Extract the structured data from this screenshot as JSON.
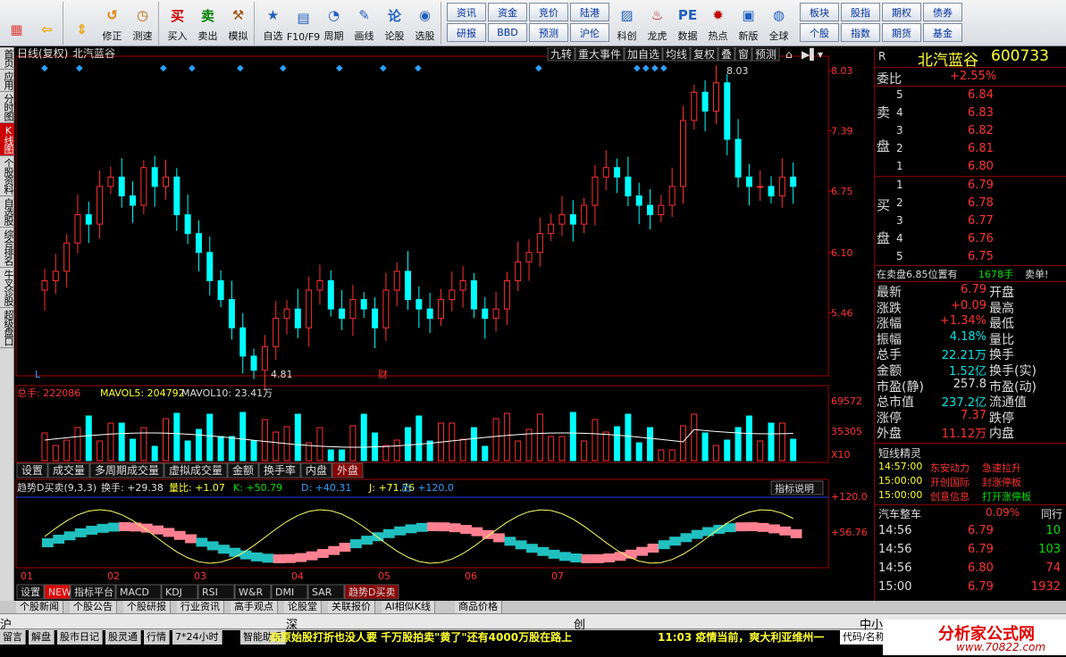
{
  "toolbar": [
    {
      "label": "",
      "icon": "grid-icon"
    },
    {
      "label": "",
      "icon": "back-arrow-icon"
    },
    {
      "label": "",
      "icon": "updown-arrow-icon"
    },
    {
      "label": "修正",
      "icon": "revise-icon"
    },
    {
      "label": "测速",
      "icon": "clock-icon"
    },
    {
      "label": "买入",
      "icon": "buy-icon",
      "glyph": "买"
    },
    {
      "label": "卖出",
      "icon": "sell-icon",
      "glyph": "卖"
    },
    {
      "label": "模拟",
      "icon": "gavel-icon"
    },
    {
      "label": "自选",
      "icon": "star-icon"
    },
    {
      "label": "F10/F9",
      "icon": "f10-icon"
    },
    {
      "label": "周期",
      "icon": "period-icon"
    },
    {
      "label": "画线",
      "icon": "pencil-icon"
    },
    {
      "label": "论股",
      "icon": "discuss-icon",
      "glyph": "论"
    },
    {
      "label": "选股",
      "icon": "pick-icon"
    }
  ],
  "quick_buttons": [
    "资讯",
    "资金",
    "竞价",
    "陆港",
    "研报",
    "BBD",
    "预测",
    "沪伦"
  ],
  "toolbar2": [
    {
      "label": "科创",
      "icon": "chart-icon"
    },
    {
      "label": "龙虎",
      "icon": "dragon-icon"
    },
    {
      "label": "数据",
      "icon": "pe-icon"
    },
    {
      "label": "热点",
      "icon": "hot-icon"
    },
    {
      "label": "新版",
      "icon": "window-icon"
    },
    {
      "label": "全球",
      "icon": "globe-icon"
    }
  ],
  "right_buttons": [
    "板块",
    "股指",
    "期权",
    "债券",
    "个股",
    "指数",
    "期货",
    "基金"
  ],
  "left_tabs": [
    {
      "label": "首页",
      "active": false
    },
    {
      "label": "应用",
      "active": false
    },
    {
      "label": "分时图",
      "active": false
    },
    {
      "label": "K线图",
      "active": true
    },
    {
      "label": "个股资料",
      "active": false
    },
    {
      "label": "自选股",
      "active": false
    },
    {
      "label": "综合排名",
      "active": false
    },
    {
      "label": "牛叉诊股",
      "active": false
    },
    {
      "label": "超级盘口",
      "active": false
    }
  ],
  "chart_header": {
    "period": "日线(复权)",
    "name": "北汽蓝谷"
  },
  "chart_tools": [
    "九转",
    "重大事件",
    "加自选",
    "均线",
    "复权",
    "叠",
    "窗",
    "预测"
  ],
  "price_axis": [
    "8.03",
    "7.39",
    "6.75",
    "6.10",
    "5.46"
  ],
  "high_label": "8.03",
  "low_label": "4.81",
  "mark_L": "L",
  "mark_cai": "财",
  "vol_header": {
    "total": "总手: 222086",
    "mavol5": "MAVOL5: 204792",
    "mavol10": "MAVOL10: 23.41万"
  },
  "vol_axis": [
    "69572",
    "35305",
    "X10"
  ],
  "vol_tabs": [
    "设置",
    "成交量",
    "多周期成交量",
    "虚拟成交量",
    "金额",
    "换手率",
    "内盘",
    "外盘"
  ],
  "ind_header": {
    "name": "趋势D买卖(9,3,3)",
    "hs": "换手: +29.38",
    "lb": "量比: +1.07",
    "k": "K: +50.79",
    "d": "D: +40.31",
    "j": "J: +71.76",
    "out": "出: +120.0"
  },
  "ind_button": "指标说明",
  "ind_axis": [
    "+120.0",
    "+56.76"
  ],
  "x_labels": [
    "01",
    "02",
    "03",
    "04",
    "05",
    "06",
    "07"
  ],
  "ind_tabs": [
    "设置",
    "NEW",
    "指标平台",
    "MACD",
    "KDJ",
    "RSI",
    "W&R",
    "DMI",
    "SAR",
    "趋势D买卖"
  ],
  "stock": {
    "tag": "R",
    "name": "北汽蓝谷",
    "code": "600733"
  },
  "weibi": {
    "label": "委比",
    "value": "+2.55%"
  },
  "sell": [
    {
      "n": "5",
      "p": "6.84"
    },
    {
      "n": "4",
      "p": "6.83"
    },
    {
      "n": "3",
      "p": "6.82"
    },
    {
      "n": "2",
      "p": "6.81"
    },
    {
      "n": "1",
      "p": "6.80"
    }
  ],
  "buy": [
    {
      "n": "1",
      "p": "6.79"
    },
    {
      "n": "2",
      "p": "6.78"
    },
    {
      "n": "3",
      "p": "6.77"
    },
    {
      "n": "4",
      "p": "6.76"
    },
    {
      "n": "5",
      "p": "6.75"
    }
  ],
  "sell_label": "卖盘",
  "buy_label": "买盘",
  "note": {
    "text": "在卖盘6.85位置有",
    "qty": "1678手",
    "tail": "卖单!"
  },
  "stats": [
    {
      "l": "最新",
      "v": "6.79",
      "r": "开盘"
    },
    {
      "l": "涨跌",
      "v": "+0.09",
      "r": "最高"
    },
    {
      "l": "涨幅",
      "v": "+1.34%",
      "r": "最低"
    },
    {
      "l": "振幅",
      "v": "4.18%",
      "r": "量比"
    },
    {
      "l": "总手",
      "v": "22.21万",
      "r": "换手"
    },
    {
      "l": "金额",
      "v": "1.52亿",
      "r": "换手(实)"
    },
    {
      "l": "市盈(静)",
      "v": "257.8",
      "r": "市盈(动)"
    },
    {
      "l": "总市值",
      "v": "237.2亿",
      "r": "流通值"
    },
    {
      "l": "涨停",
      "v": "7.37",
      "r": "跌停"
    },
    {
      "l": "外盘",
      "v": "11.12万",
      "r": "内盘"
    }
  ],
  "short_title": "短线精灵",
  "short": [
    {
      "t": "14:57:00",
      "n": "东安动力",
      "e": "急速拉升"
    },
    {
      "t": "15:00:00",
      "n": "开创国际",
      "e": "封涨停板"
    },
    {
      "t": "15:00:00",
      "n": "创意信息",
      "e": "打开涨停板"
    }
  ],
  "sector": {
    "name": "汽车整车",
    "pct": "0.09%",
    "tail": "同行"
  },
  "ticks": [
    {
      "t": "14:56",
      "p": "6.79",
      "v": "10"
    },
    {
      "t": "14:56",
      "p": "6.79",
      "v": "103"
    },
    {
      "t": "14:56",
      "p": "6.80",
      "v": "74"
    },
    {
      "t": "15:00",
      "p": "6.79",
      "v": "1932"
    }
  ],
  "bottom_tabs": [
    "个股新闻",
    "个股公告",
    "个股研报",
    "行业资讯",
    "高手观点",
    "论股堂",
    "关联报价",
    "AI相似K线",
    "商品价格"
  ],
  "markets": [
    "沪",
    "深",
    "创",
    "中小"
  ],
  "status_items": [
    "留言",
    "解盘",
    "股市日记",
    "股灵通",
    "行情",
    "7*24小时",
    "智能助手"
  ],
  "ticker1": "商原始股打折也没人要 千万股拍卖\"黄了\"还有4000万股在路上",
  "ticker2": "11:03 疫情当前，爽大利亚维州一",
  "search_hint": "代码/名称",
  "watermark": "分析家公式网",
  "watermark_url": "www.70822.com",
  "chart_data": {
    "type": "candlestick",
    "price_range": [
      4.81,
      8.03
    ],
    "closes": [
      5.8,
      5.9,
      6.2,
      6.5,
      6.4,
      6.8,
      6.9,
      6.7,
      6.6,
      7.0,
      6.8,
      6.9,
      6.5,
      6.3,
      6.1,
      5.8,
      5.6,
      5.3,
      5.0,
      4.85,
      5.1,
      5.4,
      5.5,
      5.3,
      5.7,
      5.8,
      5.5,
      5.4,
      5.6,
      5.5,
      5.3,
      5.7,
      5.9,
      5.6,
      5.5,
      5.4,
      5.6,
      5.7,
      5.8,
      5.5,
      5.4,
      5.5,
      5.8,
      6.0,
      6.1,
      6.3,
      6.4,
      6.5,
      6.4,
      6.6,
      6.9,
      7.0,
      6.9,
      6.7,
      6.6,
      6.5,
      6.6,
      6.8,
      7.5,
      7.8,
      7.6,
      7.9,
      7.3,
      6.9,
      6.8,
      6.8,
      6.7,
      6.9,
      6.8
    ]
  }
}
